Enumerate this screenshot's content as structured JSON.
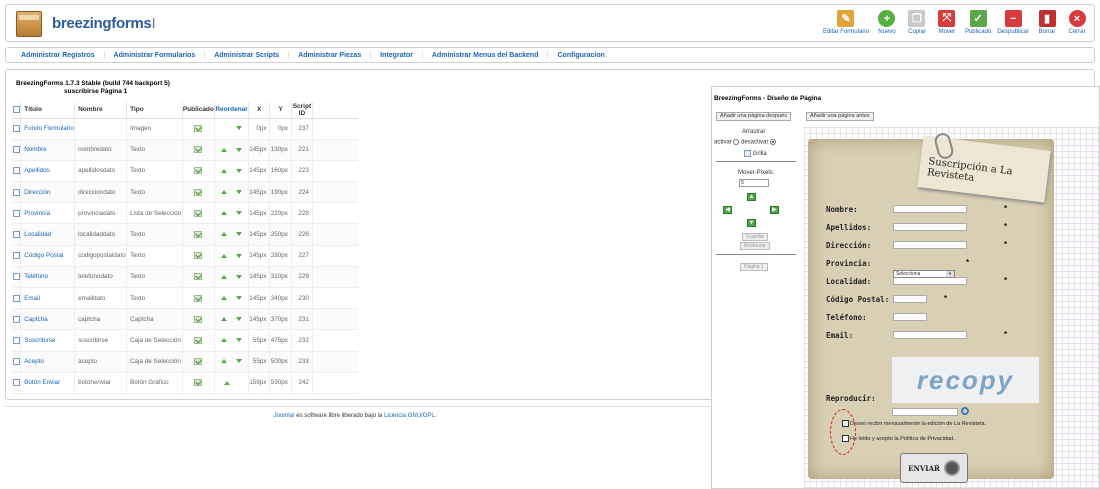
{
  "logo": {
    "text": "breezingforms",
    "suffix": "I"
  },
  "toolbar": [
    {
      "label": "Editar Formulario",
      "icon": "edit-icon",
      "color": "#e2a43a"
    },
    {
      "label": "Nuevo",
      "icon": "plus-icon",
      "color": "#56b03f"
    },
    {
      "label": "Copiar",
      "icon": "copy-icon",
      "color": "#c9c9c9"
    },
    {
      "label": "Mover",
      "icon": "move-icon",
      "color": "#d83b3b"
    },
    {
      "label": "Publicado",
      "icon": "publish-icon",
      "color": "#5aa84a"
    },
    {
      "label": "Despublicar",
      "icon": "unpublish-icon",
      "color": "#d83b3b"
    },
    {
      "label": "Borrar",
      "icon": "trash-icon",
      "color": "#c03030"
    },
    {
      "label": "Cerrar",
      "icon": "close-icon",
      "color": "#d83b3b"
    }
  ],
  "menu": [
    "Administrar Registros",
    "Administrar Formularios",
    "Administrar Scripts",
    "Administrar Piezas",
    "Integrator",
    "Administrar Menus del Backend",
    "Configuracion"
  ],
  "version": "BreezingForms 1.7.3 Stable (build 744 backport 5)",
  "page_label": "suscribirse Página 1",
  "table": {
    "headers": [
      "Título",
      "Nombre",
      "Tipo",
      "Publicado",
      "Reordenar",
      "X",
      "Y",
      "Script ID"
    ],
    "rows": [
      [
        "Fondo Formulario",
        "",
        "Imagen",
        "0px",
        "0px",
        "237"
      ],
      [
        "Nombre",
        "nombredato",
        "Texto",
        "145px",
        "130px",
        "221"
      ],
      [
        "Apellidos",
        "apellidosdato",
        "Texto",
        "145px",
        "160px",
        "223"
      ],
      [
        "Dirección",
        "direcciondato",
        "Texto",
        "145px",
        "190px",
        "224"
      ],
      [
        "Provincia",
        "provinciadato",
        "Lista de Selección",
        "145px",
        "220px",
        "228"
      ],
      [
        "Localidad",
        "localidaddato",
        "Texto",
        "145px",
        "250px",
        "226"
      ],
      [
        "Código Postal",
        "codigopostaldato",
        "Texto",
        "145px",
        "280px",
        "227"
      ],
      [
        "Teléfono",
        "telefonodato",
        "Texto",
        "145px",
        "310px",
        "229"
      ],
      [
        "Email",
        "emaildato",
        "Texto",
        "145px",
        "340px",
        "230"
      ],
      [
        "Captcha",
        "captcha",
        "Captcha",
        "145px",
        "370px",
        "231"
      ],
      [
        "Suscribirse",
        "suscribirse",
        "Caja de Selección",
        "55px",
        "475px",
        "232"
      ],
      [
        "Acepto",
        "acepto",
        "Caja de Selección",
        "55px",
        "500px",
        "233"
      ],
      [
        "Botón Enviar",
        "botonenviar",
        "Botón Gráfico",
        "159px",
        "530px",
        "242"
      ]
    ]
  },
  "designer": {
    "title": "BreezingForms - Diseño de Página",
    "btn_after": "Añadir una página después",
    "btn_before": "Añadir una página antes",
    "drag": "Arrastrar",
    "activate": "activar",
    "deactivate": "desactivar",
    "grid": "Grilla",
    "move_pixels": "Mover-Pixels:",
    "move_value": "5",
    "save": "Guardar",
    "restore": "Restaurar",
    "page": "Página 1"
  },
  "form": {
    "title": "Suscripción a La Revisteta",
    "labels": [
      "Nombre:",
      "Apellidos:",
      "Dirección:",
      "Provincia:",
      "Localidad:",
      "Código Postal:",
      "Teléfono:",
      "Email:"
    ],
    "select_value": "Selecciona",
    "captcha_text": "recopy",
    "reproduce": "Reproducir:",
    "check1": "Deseo recibir mensualmente la edición de La Revisteta.",
    "check2": "He leído y acepto la Política de Privacidad.",
    "send": "ENVIAR"
  },
  "footer": {
    "joomla": "Joomla!",
    "middle": " es software libre liberado bajo la ",
    "license": "Licencia GNU/GPL."
  }
}
